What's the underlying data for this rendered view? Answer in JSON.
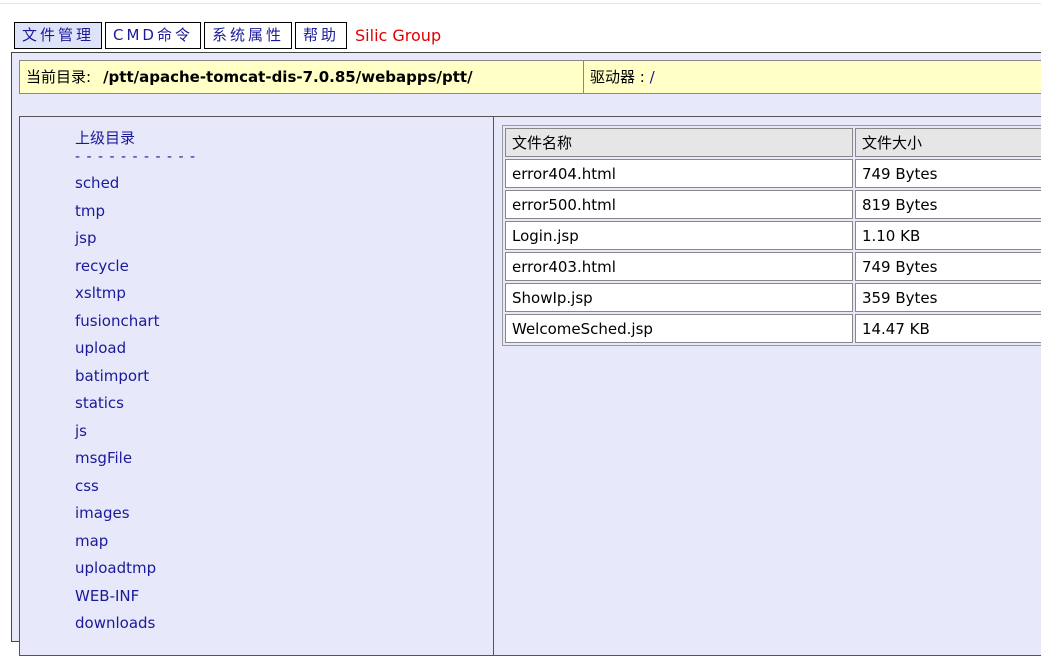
{
  "tabs": [
    {
      "label": "文件管理",
      "active": true
    },
    {
      "label": "CMD命令",
      "active": false
    },
    {
      "label": "系统属性",
      "active": false
    },
    {
      "label": "帮助",
      "active": false
    }
  ],
  "brand": "Silic Group",
  "pathbar": {
    "current_label": "当前目录:",
    "current_path": "/ptt/apache-tomcat-dis-7.0.85/webapps/ptt/",
    "drive_label": "驱动器 :",
    "drive_value": "/"
  },
  "dirs": {
    "parent": "上级目录",
    "separator": "- - - - - - - - - - -",
    "items": [
      "sched",
      "tmp",
      "jsp",
      "recycle",
      "xsltmp",
      "fusionchart",
      "upload",
      "batimport",
      "statics",
      "js",
      "msgFile",
      "css",
      "images",
      "map",
      "uploadtmp",
      "WEB-INF",
      "downloads"
    ]
  },
  "files": {
    "headers": {
      "name": "文件名称",
      "size": "文件大小"
    },
    "rows": [
      {
        "name": "error404.html",
        "size": "749 Bytes"
      },
      {
        "name": "error500.html",
        "size": "819 Bytes"
      },
      {
        "name": "Login.jsp",
        "size": "1.10 KB"
      },
      {
        "name": "error403.html",
        "size": "749 Bytes"
      },
      {
        "name": "ShowIp.jsp",
        "size": "359 Bytes"
      },
      {
        "name": "WelcomeSched.jsp",
        "size": "14.47 KB"
      }
    ]
  },
  "colors": {
    "link": "#1a1a9a",
    "brand": "#e00000",
    "pathbar_bg": "#ffffc6",
    "pane_bg": "#e8e8fb"
  }
}
